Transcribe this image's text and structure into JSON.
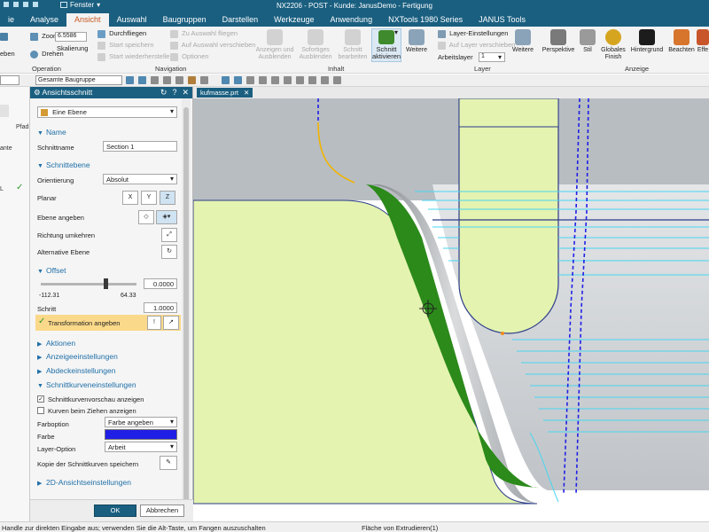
{
  "titlebar": {
    "fenster": "Fenster",
    "title": "NX2206 - POST - Kunde: JanusDemo - Fertigung"
  },
  "tabs": [
    "ie",
    "Analyse",
    "Ansicht",
    "Auswahl",
    "Baugruppen",
    "Darstellen",
    "Werkzeuge",
    "Anwendung",
    "NXTools 1980 Series",
    "JANUS Tools"
  ],
  "active_tab": "Ansicht",
  "ribbon": {
    "operation": {
      "zoomen": "Zoomen",
      "zoom_value": "6.5586",
      "skalierung": "Skalierung",
      "eben": "eben",
      "drehen": "Drehen",
      "label": "Operation"
    },
    "navigation": {
      "durchfliegen": "Durchfliegen",
      "start_speichern": "Start speichern",
      "start_wiederherstellen": "Start wiederherstellen",
      "zu_auswahl_fliegen": "Zu Auswahl fliegen",
      "auf_auswahl_verschieben": "Auf Auswahl verschieben",
      "optionen": "Optionen",
      "label": "Navigation"
    },
    "inhalt": {
      "anzeigen": "Anzeigen und Ausblenden",
      "sofortiges": "Sofortiges Ausblenden",
      "schnitt_bearbeiten": "Schnitt bearbeiten",
      "schnitt_aktivieren": "Schnitt aktivieren",
      "weitere": "Weitere",
      "label": "Inhalt"
    },
    "layer": {
      "einstellungen": "Layer-Einstellungen",
      "auf_layer": "Auf Layer verschieben",
      "arbeitslayer": "Arbeitslayer",
      "arbeitslayer_value": "1",
      "weitere": "Weitere",
      "label": "Layer"
    },
    "anzeige": {
      "perspektive": "Perspektive",
      "stil": "Stil",
      "globales": "Globales Finish",
      "hintergrund": "Hintergrund",
      "beachten": "Beachten",
      "effe": "Effe",
      "label": "Anzeige"
    }
  },
  "toolbar2": {
    "dropdown1": "",
    "gesamte": "Gesamte Baugruppe"
  },
  "leftstrip": {
    "pfad": "Pfad",
    "ante": "ante",
    "l": "L"
  },
  "dialog": {
    "title": "Ansichtsschnitt",
    "type_value": "Eine Ebene",
    "name_section": "Name",
    "schnittname_label": "Schnittname",
    "schnittname_value": "Section 1",
    "schnittebene_section": "Schnittebene",
    "orientierung_label": "Orientierung",
    "orientierung_value": "Absolut",
    "planar_label": "Planar",
    "ebene_angeben": "Ebene angeben",
    "richtung_umkehren": "Richtung umkehren",
    "alternative_ebene": "Alternative Ebene",
    "offset_section": "Offset",
    "slider_min": "-112.31",
    "slider_max": "64.33",
    "slider_level": 0.68,
    "offset_value": "0.0000",
    "schritt_label": "Schritt",
    "schritt_value": "1.0000",
    "transformation": "Transformation angeben",
    "aktionen": "Aktionen",
    "anzeigeeinstellungen": "Anzeigeeinstellungen",
    "abdeckeinstellungen": "Abdeckeinstellungen",
    "schnittkurven_section": "Schnittkurveneinstellungen",
    "vorschau_label": "Schnittkurvenvorschau anzeigen",
    "vorschau_checked": true,
    "kurven_ziehen_label": "Kurven beim Ziehen anzeigen",
    "kurven_ziehen_checked": false,
    "farboption_label": "Farboption",
    "farboption_value": "Farbe angeben",
    "farbe_label": "Farbe",
    "farbe_color": "#1f1fe6",
    "layer_option_label": "Layer-Option",
    "layer_option_value": "Arbeit",
    "kopie_label": "Kopie der Schnittkurven speichern",
    "ansicht_2d": "2D-Ansichtseinstellungen",
    "ok": "OK",
    "abbrechen": "Abbrechen"
  },
  "viewport": {
    "tab_label": "kufmasse.prt"
  },
  "colors": {
    "accent": "#1a5f80",
    "part_light": "#e4f3b0",
    "part_green": "#2b8a1a",
    "section_curve": "#1f1fe6",
    "toolpath": "#47d6f0"
  },
  "statusbar": {
    "left": "Handle zur direkten Eingabe aus; verwenden Sie die Alt-Taste, um Fangen auszuschalten",
    "right": "Fläche von Extrudieren(1)"
  }
}
